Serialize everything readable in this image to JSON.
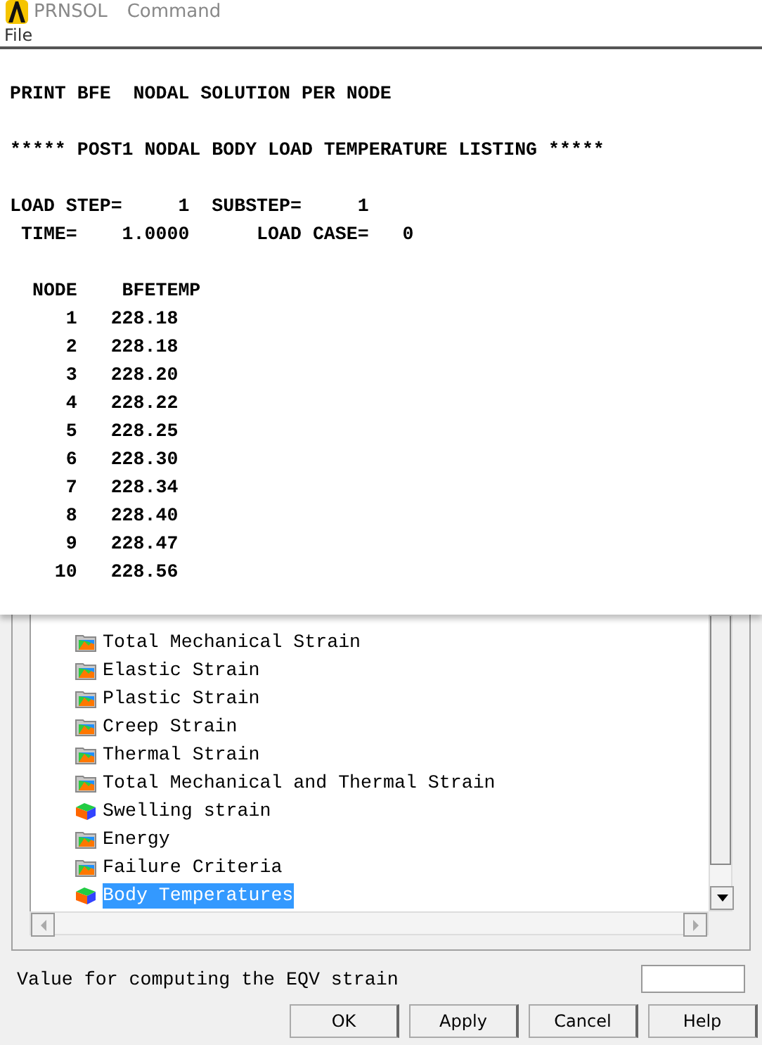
{
  "window": {
    "title": "PRNSOL",
    "subtitle": "Command"
  },
  "menu": [
    "File"
  ],
  "output": [
    [
      "PRINT BFE  NODAL SOLUTION PER NODE"
    ],
    [
      "***** POST1 NODAL BODY LOAD TEMPERATURE LISTING *****"
    ],
    [
      "LOAD STEP=     1  SUBSTEP=     1",
      " TIME=    1.0000      LOAD CASE=   0"
    ],
    [
      "  NODE    BFETEMP",
      "     1   228.18",
      "     2   228.18",
      "     3   228.20",
      "     4   228.22",
      "     5   228.25",
      "     6   228.30",
      "     7   228.34",
      "     8   228.40",
      "     9   228.47",
      "    10   228.56"
    ]
  ],
  "tree": [
    {
      "label": "Total Mechanical Strain",
      "kind": "folder",
      "selected": false
    },
    {
      "label": "Elastic Strain",
      "kind": "folder",
      "selected": false
    },
    {
      "label": "Plastic Strain",
      "kind": "folder",
      "selected": false
    },
    {
      "label": "Creep Strain",
      "kind": "folder",
      "selected": false
    },
    {
      "label": "Thermal Strain",
      "kind": "folder",
      "selected": false
    },
    {
      "label": "Total Mechanical and Thermal Strain",
      "kind": "folder",
      "selected": false
    },
    {
      "label": "Swelling strain",
      "kind": "cube",
      "selected": false
    },
    {
      "label": "Energy",
      "kind": "folder",
      "selected": false
    },
    {
      "label": "Failure Criteria",
      "kind": "folder",
      "selected": false
    },
    {
      "label": "Body Temperatures",
      "kind": "cube",
      "selected": true
    }
  ],
  "eqv_label": "Value for computing the EQV strain",
  "buttons": [
    "OK",
    "Apply",
    "Cancel",
    "Help"
  ]
}
